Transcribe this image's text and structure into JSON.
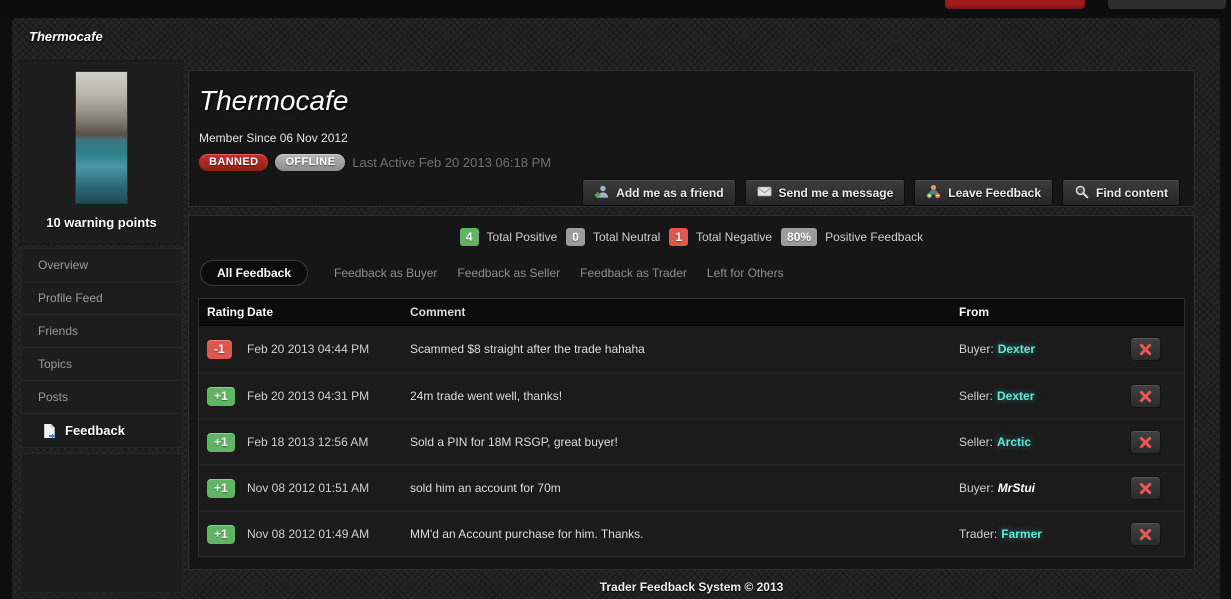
{
  "breadcrumb": {
    "title": "Thermocafe"
  },
  "sidebar": {
    "warning_text": "10 warning points",
    "nav": [
      {
        "label": "Overview",
        "active": false
      },
      {
        "label": "Profile Feed",
        "active": false
      },
      {
        "label": "Friends",
        "active": false
      },
      {
        "label": "Topics",
        "active": false
      },
      {
        "label": "Posts",
        "active": false
      },
      {
        "label": "Feedback",
        "active": true
      }
    ]
  },
  "profile": {
    "username": "Thermocafe",
    "member_since": "Member Since 06 Nov 2012",
    "badges": [
      {
        "label": "BANNED",
        "color": "#a8271f"
      },
      {
        "label": "OFFLINE",
        "color": "#9a9a9a"
      }
    ],
    "last_active": "Last Active Feb 20 2013 06:18 PM",
    "actions": [
      {
        "label": "Add me as a friend",
        "icon": "add-friend-icon"
      },
      {
        "label": "Send me a message",
        "icon": "message-icon"
      },
      {
        "label": "Leave Feedback",
        "icon": "leave-feedback-icon"
      },
      {
        "label": "Find content",
        "icon": "find-content-icon"
      }
    ]
  },
  "feedback": {
    "summary": [
      {
        "value": "4",
        "label": "Total Positive",
        "color": "#5fb564"
      },
      {
        "value": "0",
        "label": "Total Neutral",
        "color": "#9c9c9c"
      },
      {
        "value": "1",
        "label": "Total Negative",
        "color": "#df574f"
      },
      {
        "value": "80%",
        "label": "Positive Feedback",
        "color": "#9c9c9c"
      }
    ],
    "tabs": [
      {
        "label": "All Feedback",
        "active": true
      },
      {
        "label": "Feedback as Buyer",
        "active": false
      },
      {
        "label": "Feedback as Seller",
        "active": false
      },
      {
        "label": "Feedback as Trader",
        "active": false
      },
      {
        "label": "Left for Others",
        "active": false
      }
    ],
    "table": {
      "headers": [
        "Rating",
        "Date",
        "Comment",
        "From"
      ],
      "rows": [
        {
          "rating": "-1",
          "type": "negative",
          "date": "Feb 20 2013 04:44 PM",
          "comment": "Scammed $8 straight after the trade hahaha",
          "from_role": "Buyer:",
          "from_name": "Dexter",
          "name_style": "member"
        },
        {
          "rating": "+1",
          "type": "positive",
          "date": "Feb 20 2013 04:31 PM",
          "comment": "24m trade went well, thanks!",
          "from_role": "Seller:",
          "from_name": "Dexter",
          "name_style": "member"
        },
        {
          "rating": "+1",
          "type": "positive",
          "date": "Feb 18 2013 12:56 AM",
          "comment": "Sold a PIN for 18M RSGP, great buyer!",
          "from_role": "Seller:",
          "from_name": "Arctic",
          "name_style": "member"
        },
        {
          "rating": "+1",
          "type": "positive",
          "date": "Nov 08 2012 01:51 AM",
          "comment": "sold him an account for 70m",
          "from_role": "Buyer:",
          "from_name": "MrStui",
          "name_style": "guest"
        },
        {
          "rating": "+1",
          "type": "positive",
          "date": "Nov 08 2012 01:49 AM",
          "comment": "MM'd an Account purchase for him. Thanks.",
          "from_role": "Trader:",
          "from_name": "Farmer",
          "name_style": "member"
        }
      ]
    },
    "footer": "Trader Feedback System © 2013"
  },
  "colors": {
    "positive": "#5fb564",
    "negative": "#df574f",
    "neutral": "#9c9c9c",
    "username_accent": "#5ee8d9",
    "banned_badge": "#a8271f",
    "topbar_accent": "#a31d1d"
  }
}
